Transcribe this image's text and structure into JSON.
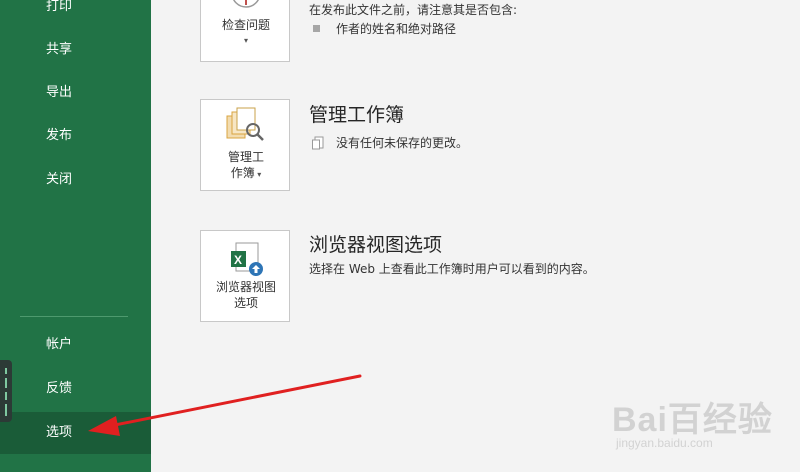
{
  "sidebar": {
    "items_top": [
      {
        "label": "打印"
      },
      {
        "label": "共享"
      },
      {
        "label": "导出"
      },
      {
        "label": "发布"
      },
      {
        "label": "关闭"
      }
    ],
    "items_bottom": [
      {
        "label": "帐户"
      },
      {
        "label": "反馈"
      },
      {
        "label": "选项",
        "active": true
      }
    ],
    "bg_color": "#217346"
  },
  "inspect": {
    "button_label": "检查问题",
    "description": "在发布此文件之前，请注意其是否包含:",
    "bullet": "作者的姓名和绝对路径"
  },
  "manage": {
    "title": "管理工作簿",
    "button_label_line1": "管理工",
    "button_label_line2": "作簿",
    "status": "没有任何未保存的更改。"
  },
  "browser": {
    "title": "浏览器视图选项",
    "button_label_line1": "浏览器视图",
    "button_label_line2": "选项",
    "description": "选择在 Web 上查看此工作簿时用户可以看到的内容。"
  },
  "annotation": {
    "arrow_color": "#e02020"
  },
  "watermark": {
    "logo": "Bai百经验",
    "url": "jingyan.baidu.com"
  }
}
